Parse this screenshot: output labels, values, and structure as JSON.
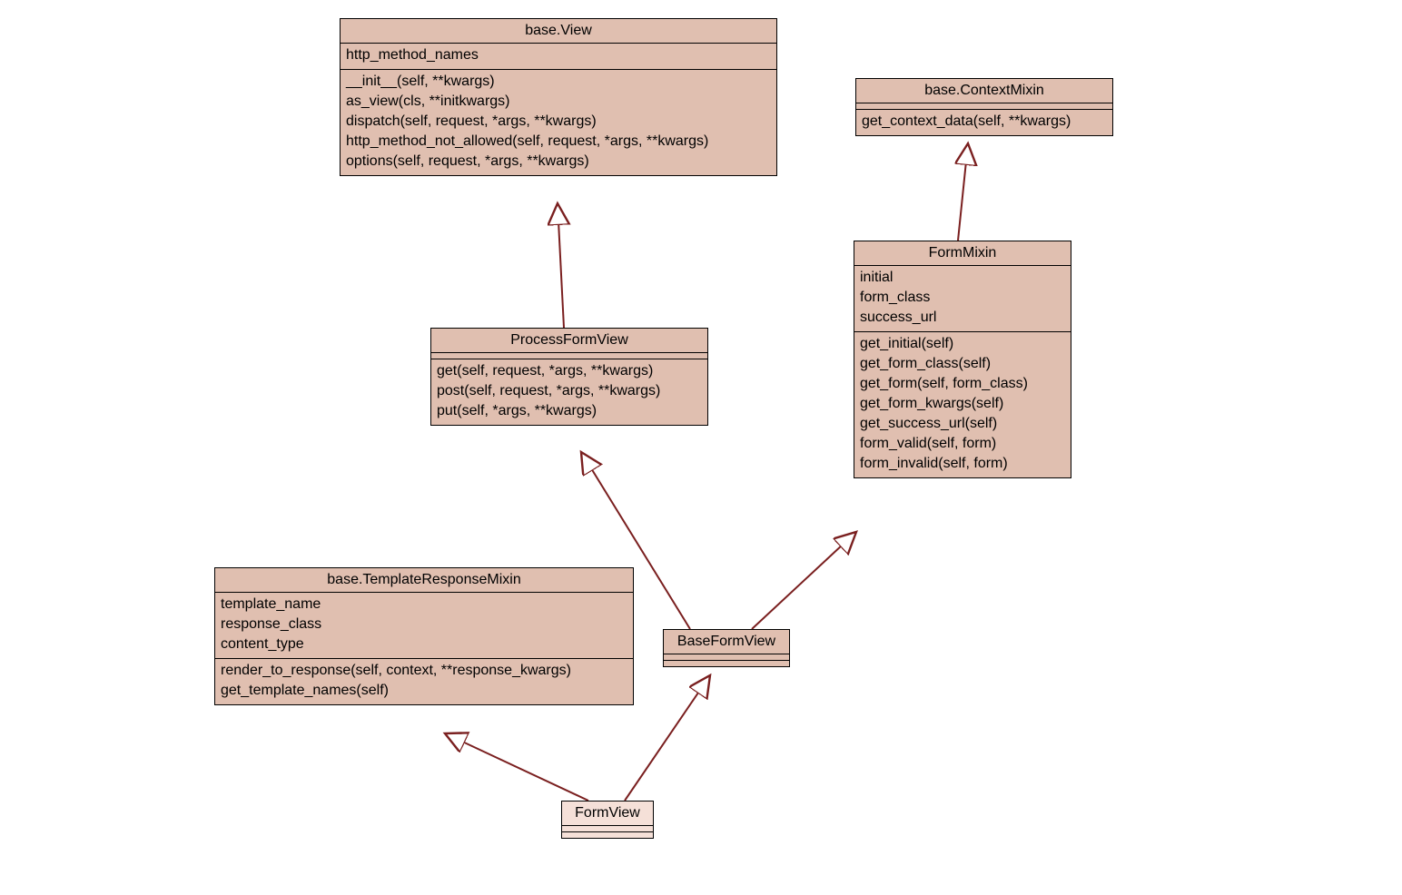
{
  "classes": {
    "baseView": {
      "title": "base.View",
      "attrs": [
        "http_method_names"
      ],
      "methods": [
        "__init__(self, **kwargs)",
        "as_view(cls, **initkwargs)",
        "dispatch(self, request, *args, **kwargs)",
        "http_method_not_allowed(self, request, *args, **kwargs)",
        "options(self, request, *args, **kwargs)"
      ]
    },
    "contextMixin": {
      "title": "base.ContextMixin",
      "attrs": [],
      "methods": [
        "get_context_data(self, **kwargs)"
      ]
    },
    "processFormView": {
      "title": "ProcessFormView",
      "attrs": [],
      "methods": [
        "get(self, request, *args, **kwargs)",
        "post(self, request, *args, **kwargs)",
        "put(self, *args, **kwargs)"
      ]
    },
    "formMixin": {
      "title": "FormMixin",
      "attrs": [
        "initial",
        "form_class",
        "success_url"
      ],
      "methods": [
        "get_initial(self)",
        "get_form_class(self)",
        "get_form(self, form_class)",
        "get_form_kwargs(self)",
        "get_success_url(self)",
        "form_valid(self, form)",
        "form_invalid(self, form)"
      ]
    },
    "templateResponseMixin": {
      "title": "base.TemplateResponseMixin",
      "attrs": [
        "template_name",
        "response_class",
        "content_type"
      ],
      "methods": [
        "render_to_response(self, context, **response_kwargs)",
        "get_template_names(self)"
      ]
    },
    "baseFormView": {
      "title": "BaseFormView",
      "attrs": [],
      "methods": []
    },
    "formView": {
      "title": "FormView",
      "attrs": [],
      "methods": []
    }
  },
  "colors": {
    "boxFill": "#e0bfb0",
    "boxFillLight": "#f5e0d8",
    "edge": "#7a1f1f"
  }
}
